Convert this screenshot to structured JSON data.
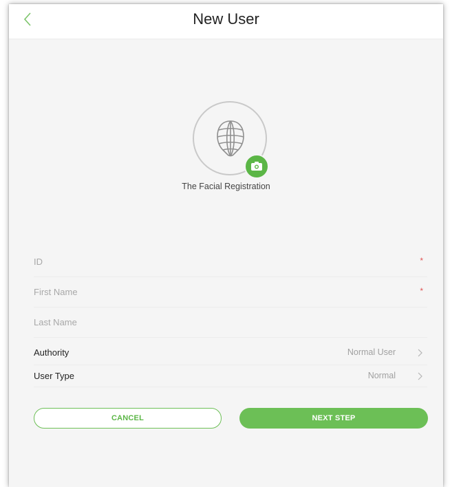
{
  "header": {
    "title": "New User",
    "back_icon": "chevron-left-icon"
  },
  "avatar": {
    "face_icon": "face-mesh-icon",
    "camera_icon": "camera-icon",
    "caption": "The Facial Registration"
  },
  "form": {
    "id_label": "ID",
    "first_name_label": "First Name",
    "last_name_label": "Last Name",
    "authority_label": "Authority",
    "authority_value": "Normal User",
    "user_type_label": "User Type",
    "user_type_value": "Normal",
    "required_mark": "*"
  },
  "buttons": {
    "cancel": "CANCEL",
    "next": "NEXT STEP"
  },
  "colors": {
    "accent": "#5bb646",
    "required": "#e05454"
  }
}
